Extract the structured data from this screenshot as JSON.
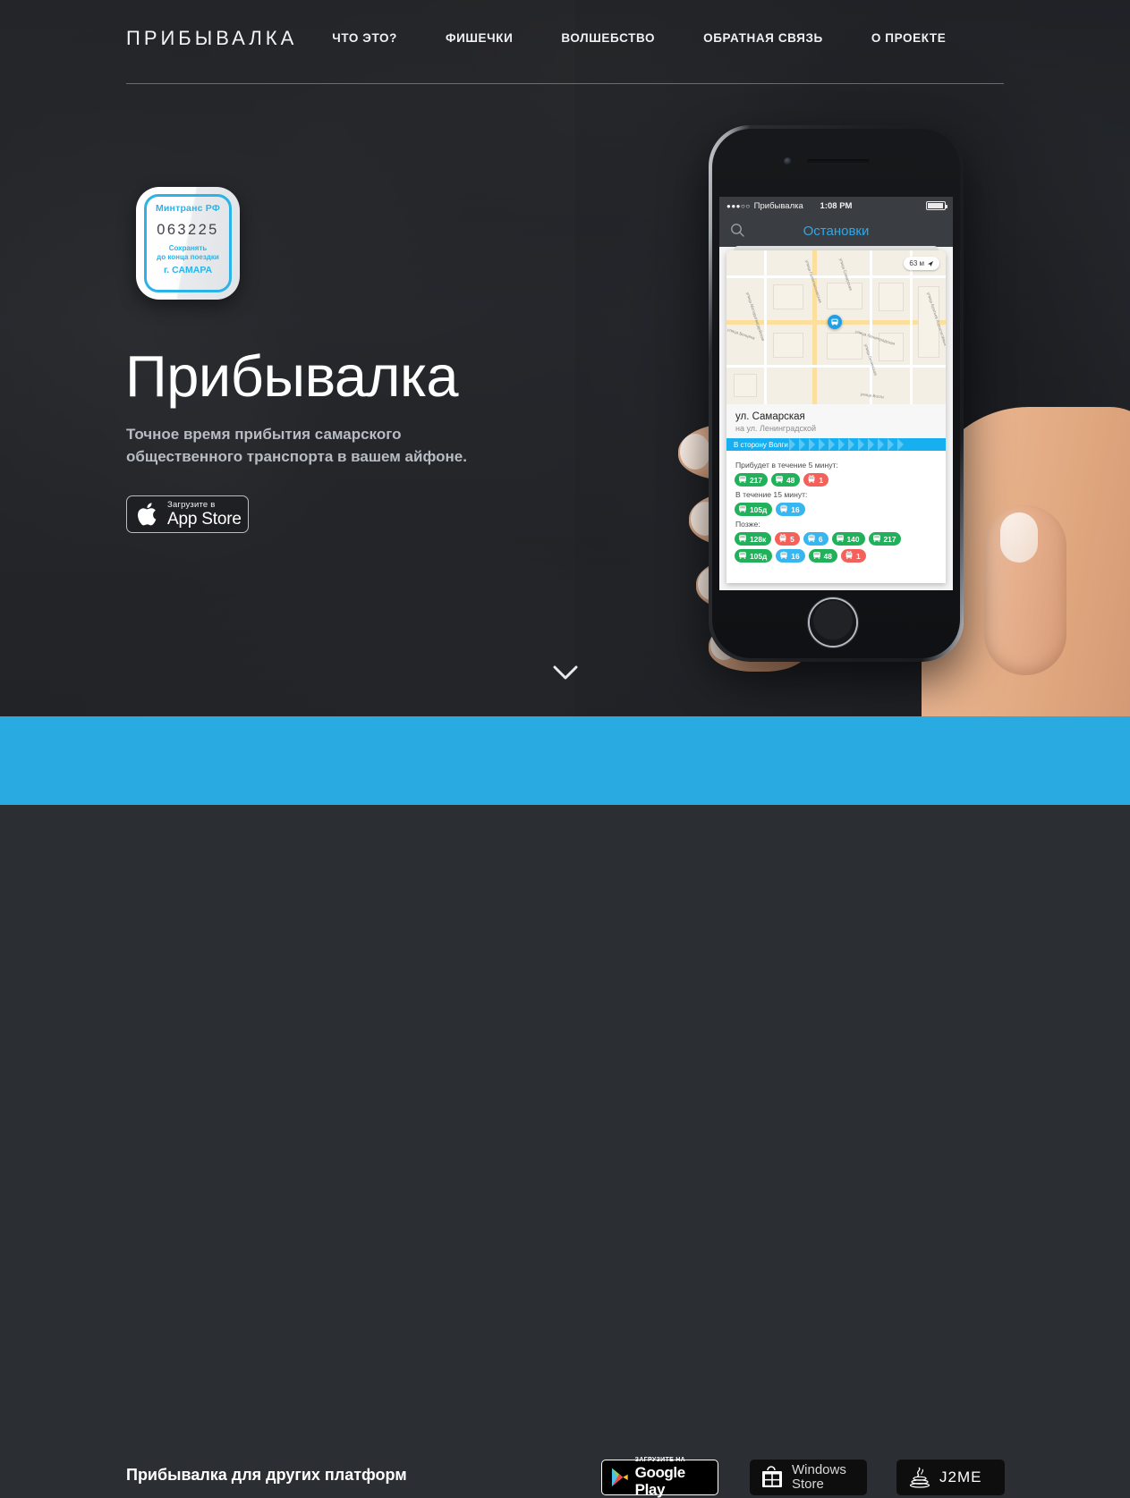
{
  "nav": {
    "brand": "ПРИБЫВАЛКА",
    "links": [
      {
        "label": "ЧТО ЭТО?"
      },
      {
        "label": "ФИШЕЧКИ"
      },
      {
        "label": "ВОЛШЕБСТВО"
      },
      {
        "label": "ОБРАТНАЯ СВЯЗЬ"
      },
      {
        "label": "О ПРОЕКТЕ"
      }
    ]
  },
  "hero": {
    "app_icon": {
      "top_label": "Минтранс РФ",
      "number": "063225",
      "note_line1": "Сохранять",
      "note_line2": "до конца поездки",
      "city": "г. САМАРА"
    },
    "title": "Прибывалка",
    "subtitle_line1": "Точное время прибытия самарского",
    "subtitle_line2": "общественного транспорта в вашем айфоне.",
    "appstore": {
      "small": "Загрузите в",
      "big": "App Store"
    },
    "scroll_hint": "chevron-down-icon"
  },
  "phone": {
    "status_bar": {
      "signal": "●●●○○",
      "carrier": "Прибывалка",
      "time": "1:08 PM"
    },
    "navbar": {
      "title": "Остановки",
      "search_icon": "search-icon"
    },
    "map": {
      "distance": "63 м",
      "streets": [
        "улица Молодогвардейская",
        "улица Галактионовская",
        "улица Самарская",
        "улица Ленинградская",
        "улица Братьев Коростелёвых",
        "улица Ленинская",
        "улица Венцека",
        "улица Волги"
      ]
    },
    "stop": {
      "name": "ул. Самарская",
      "sub": "на ул. Ленинградской",
      "direction": "В сторону Волги"
    },
    "arrivals": [
      {
        "label": "Прибудет в течение 5 минут:",
        "routes": [
          {
            "number": "217",
            "type": "bus",
            "color": "#21b15a"
          },
          {
            "number": "48",
            "type": "bus",
            "color": "#21b15a"
          },
          {
            "number": "1",
            "type": "trolleybus",
            "color": "#f4615a"
          }
        ]
      },
      {
        "label": "В течение 15 минут:",
        "routes": [
          {
            "number": "105д",
            "type": "bus",
            "color": "#21b15a"
          },
          {
            "number": "16",
            "type": "tram",
            "color": "#37b6f0"
          }
        ]
      },
      {
        "label": "Позже:",
        "routes": [
          {
            "number": "128к",
            "type": "bus",
            "color": "#21b15a"
          },
          {
            "number": "5",
            "type": "trolleybus",
            "color": "#f4615a"
          },
          {
            "number": "6",
            "type": "tram",
            "color": "#37b6f0"
          },
          {
            "number": "140",
            "type": "bus",
            "color": "#21b15a"
          },
          {
            "number": "217",
            "type": "bus",
            "color": "#21b15a"
          },
          {
            "number": "105д",
            "type": "bus",
            "color": "#21b15a"
          },
          {
            "number": "16",
            "type": "tram",
            "color": "#37b6f0"
          },
          {
            "number": "48",
            "type": "bus",
            "color": "#21b15a"
          },
          {
            "number": "1",
            "type": "trolleybus",
            "color": "#f4615a"
          }
        ]
      }
    ]
  },
  "footer": {
    "title": "Прибывалка для других платформ",
    "background_color": "#29abe2",
    "buttons": {
      "google_play": {
        "small": "ЗАГРУЗИТЕ НА",
        "big": "Google Play"
      },
      "windows_store": {
        "line1": "Windows",
        "line2": "Store"
      },
      "j2me": {
        "label": "J2ME"
      }
    }
  }
}
